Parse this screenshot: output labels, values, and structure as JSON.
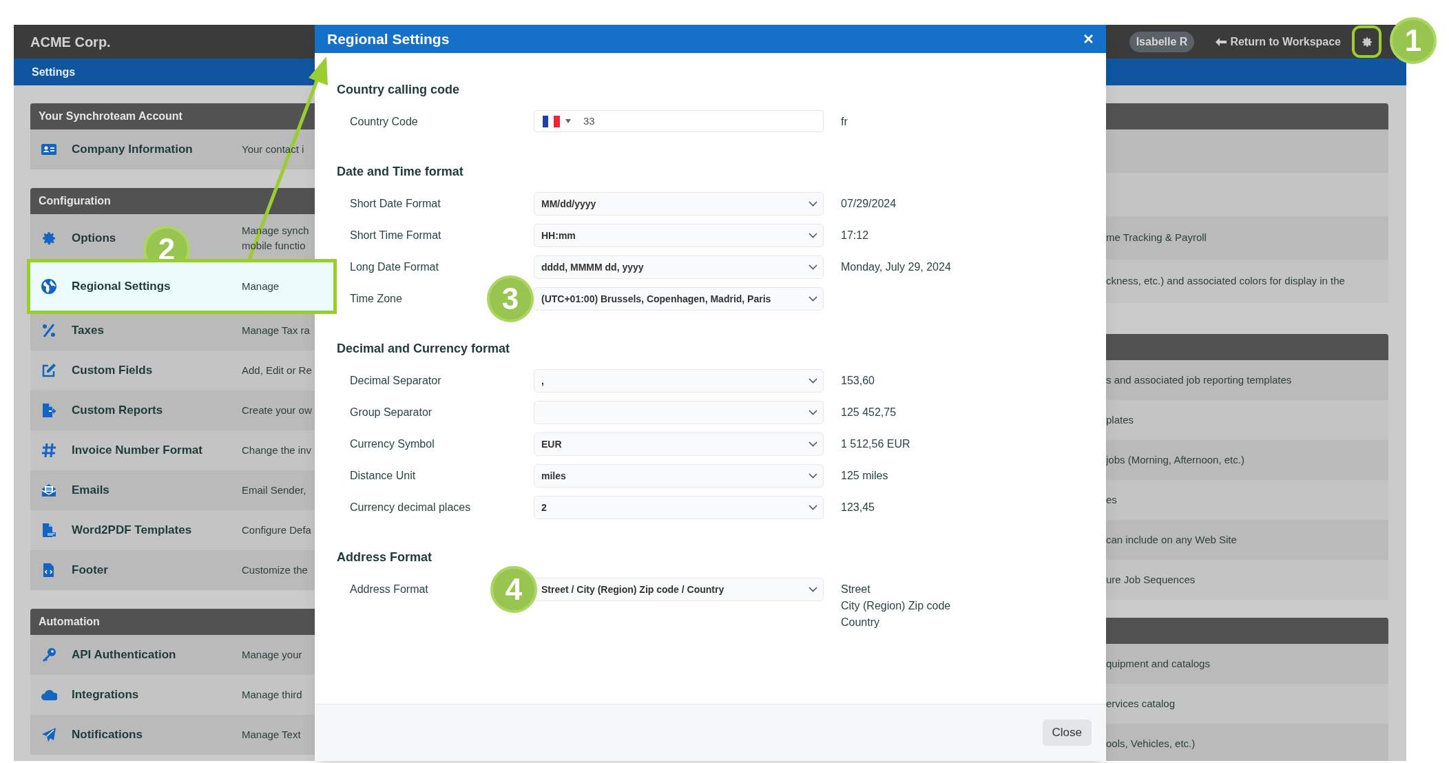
{
  "app": {
    "company": "ACME Corp.",
    "user": "Isabelle R",
    "return_link": "Return to Workspace",
    "breadcrumb": "Settings"
  },
  "left_sections": [
    {
      "title": "Your Synchroteam Account",
      "items": [
        {
          "kind": "id-card",
          "label": "Company Information",
          "description": [
            "Your contact i"
          ],
          "selected": false
        }
      ]
    },
    {
      "title": "Configuration",
      "items": [
        {
          "kind": "gear",
          "label": "Options",
          "description": [
            "Manage synch",
            "mobile functio"
          ],
          "selected": false
        },
        {
          "kind": "globe",
          "label": "Regional Settings",
          "description": [
            "Manage"
          ],
          "selected": true
        },
        {
          "kind": "percent",
          "label": "Taxes",
          "description": [
            "Manage Tax ra"
          ],
          "selected": false
        },
        {
          "kind": "edit",
          "label": "Custom Fields",
          "description": [
            "Add, Edit or Re"
          ],
          "selected": false
        },
        {
          "kind": "file-arrow",
          "label": "Custom Reports",
          "description": [
            "Create your ow"
          ],
          "selected": false
        },
        {
          "kind": "hash",
          "label": "Invoice Number Format",
          "description": [
            "Change the inv"
          ],
          "selected": false
        },
        {
          "kind": "envelope",
          "label": "Emails",
          "description": [
            "Email Sender,"
          ],
          "selected": false
        },
        {
          "kind": "file-pdf",
          "label": "Word2PDF Templates",
          "description": [
            "Configure Defa"
          ],
          "selected": false
        },
        {
          "kind": "file-code",
          "label": "Footer",
          "description": [
            "Customize the"
          ],
          "selected": false
        }
      ]
    },
    {
      "title": "Automation",
      "items": [
        {
          "kind": "key",
          "label": "API Authentication",
          "description": [
            "Manage your"
          ],
          "selected": false
        },
        {
          "kind": "cloud",
          "label": "Integrations",
          "description": [
            "Manage third"
          ],
          "selected": false
        },
        {
          "kind": "plane",
          "label": "Notifications",
          "description": [
            "Manage Text"
          ],
          "selected": false
        }
      ]
    }
  ],
  "right_sections": [
    {
      "rows": [
        {},
        {},
        {
          "text": "me Tracking & Payroll"
        },
        {
          "text": "ckness, etc.) and associated colors for display in the"
        }
      ]
    },
    {
      "rows": [
        {
          "text": "s and associated job reporting templates"
        },
        {
          "text": "plates"
        },
        {
          "text": "jobs (Morning, Afternoon, etc.)"
        },
        {
          "text": "es"
        },
        {
          "text": "can include on any Web Site"
        },
        {
          "text": "ure Job Sequences"
        }
      ]
    },
    {
      "rows": [
        {
          "text": "quipment and catalogs"
        },
        {
          "text": "ervices catalog"
        },
        {
          "text": "ools, Vehicles, etc.)"
        }
      ]
    }
  ],
  "dialog": {
    "title": "Regional Settings",
    "sections": [
      {
        "title": "Country calling code",
        "rows": [
          {
            "kind": "phone",
            "label": "Country Code",
            "value": "33",
            "preview": [
              "fr"
            ]
          }
        ]
      },
      {
        "title": "Date and Time format",
        "rows": [
          {
            "kind": "select",
            "label": "Short Date Format",
            "value": "MM/dd/yyyy",
            "preview": [
              "07/29/2024"
            ]
          },
          {
            "kind": "select",
            "label": "Short Time Format",
            "value": "HH:mm",
            "preview": [
              "17:12"
            ]
          },
          {
            "kind": "select",
            "label": "Long Date Format",
            "value": "dddd, MMMM dd, yyyy",
            "preview": [
              "Monday, July 29, 2024"
            ]
          },
          {
            "kind": "select",
            "label": "Time Zone",
            "value": "(UTC+01:00) Brussels, Copenhagen, Madrid, Paris"
          }
        ]
      },
      {
        "title": "Decimal and Currency format",
        "rows": [
          {
            "kind": "select",
            "label": "Decimal Separator",
            "value": ",",
            "preview": [
              "153,60"
            ]
          },
          {
            "kind": "select",
            "label": "Group Separator",
            "preview": [
              "125 452,75"
            ]
          },
          {
            "kind": "select",
            "label": "Currency Symbol",
            "value": "EUR",
            "preview": [
              "1 512,56 EUR"
            ]
          },
          {
            "kind": "select",
            "label": "Distance Unit",
            "value": "miles",
            "preview": [
              "125 miles"
            ]
          },
          {
            "kind": "select",
            "label": "Currency decimal places",
            "value": "2",
            "preview": [
              "123,45"
            ]
          }
        ]
      },
      {
        "title": "Address Format",
        "rows": [
          {
            "kind": "select",
            "label": "Address Format",
            "value": "Street / City (Region) Zip code / Country",
            "preview": [
              "Street",
              "City (Region) Zip code",
              "Country"
            ]
          }
        ]
      }
    ],
    "footer_button": "Close"
  },
  "callouts": [
    {
      "label": "1"
    },
    {
      "label": "2"
    },
    {
      "label": "3"
    },
    {
      "label": "4"
    }
  ]
}
